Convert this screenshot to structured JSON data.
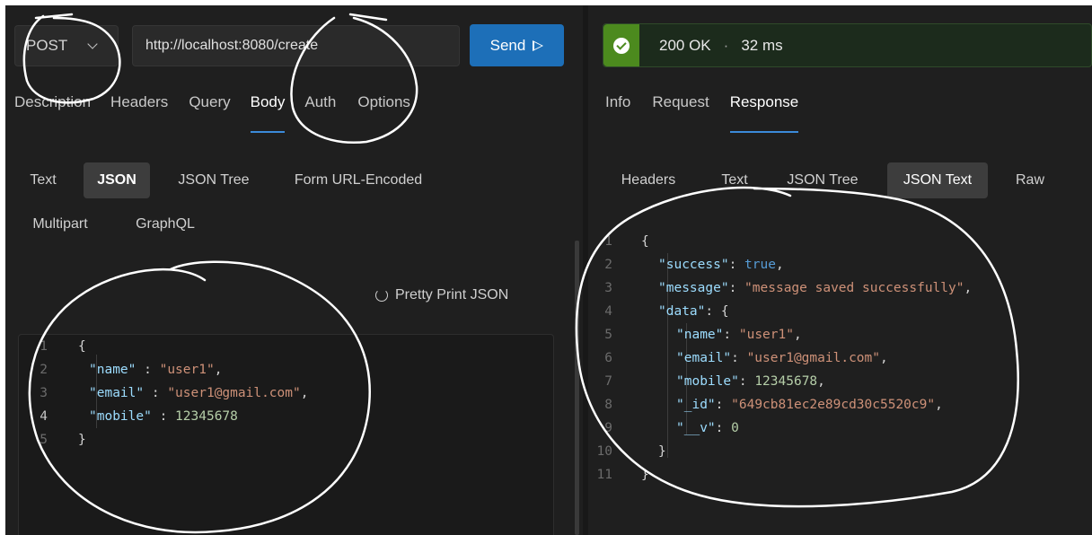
{
  "request": {
    "method": "POST",
    "url": "http://localhost:8080/create",
    "send_label": "Send",
    "tabs": [
      {
        "label": "Description",
        "active": false
      },
      {
        "label": "Headers",
        "active": false
      },
      {
        "label": "Query",
        "active": false
      },
      {
        "label": "Body",
        "active": true
      },
      {
        "label": "Auth",
        "active": false
      },
      {
        "label": "Options",
        "active": false
      }
    ],
    "body_types": [
      "Text",
      "JSON",
      "JSON Tree",
      "Form URL-Encoded",
      "Multipart",
      "GraphQL"
    ],
    "active_body_type": "JSON",
    "pretty_print_label": "Pretty Print JSON",
    "editor_lines": [
      {
        "n": "1",
        "code": "{"
      },
      {
        "n": "2",
        "code": "\"name\" : \"user1\","
      },
      {
        "n": "3",
        "code": "\"email\" : \"user1@gmail.com\","
      },
      {
        "n": "4",
        "code": "\"mobile\" : 12345678"
      },
      {
        "n": "5",
        "code": "}"
      }
    ]
  },
  "response": {
    "status": "200 OK",
    "separator": "·",
    "time": "32 ms",
    "tabs": [
      {
        "label": "Info",
        "active": false
      },
      {
        "label": "Request",
        "active": false
      },
      {
        "label": "Response",
        "active": true
      }
    ],
    "view_modes": [
      "Headers",
      "Text",
      "JSON Tree",
      "JSON Text",
      "Raw"
    ],
    "active_view_mode": "JSON Text",
    "json_lines": [
      {
        "n": "1",
        "code": "{"
      },
      {
        "n": "2",
        "code": "\"success\": true,"
      },
      {
        "n": "3",
        "code": "\"message\": \"message saved successfully\","
      },
      {
        "n": "4",
        "code": "\"data\": {"
      },
      {
        "n": "5",
        "code": "\"name\": \"user1\","
      },
      {
        "n": "6",
        "code": "\"email\": \"user1@gmail.com\","
      },
      {
        "n": "7",
        "code": "\"mobile\": 12345678,"
      },
      {
        "n": "8",
        "code": "\"_id\": \"649cb81ec2e89cd30c5520c9\","
      },
      {
        "n": "9",
        "code": "\"__v\": 0"
      },
      {
        "n": "10",
        "code": "}"
      },
      {
        "n": "11",
        "code": "}"
      }
    ]
  },
  "colors": {
    "accent": "#1d6fb8",
    "success": "#4c8a1e",
    "json_key": "#9cdcfe",
    "json_string": "#ce9178",
    "json_number": "#b5cea8",
    "json_bool": "#569cd6"
  }
}
